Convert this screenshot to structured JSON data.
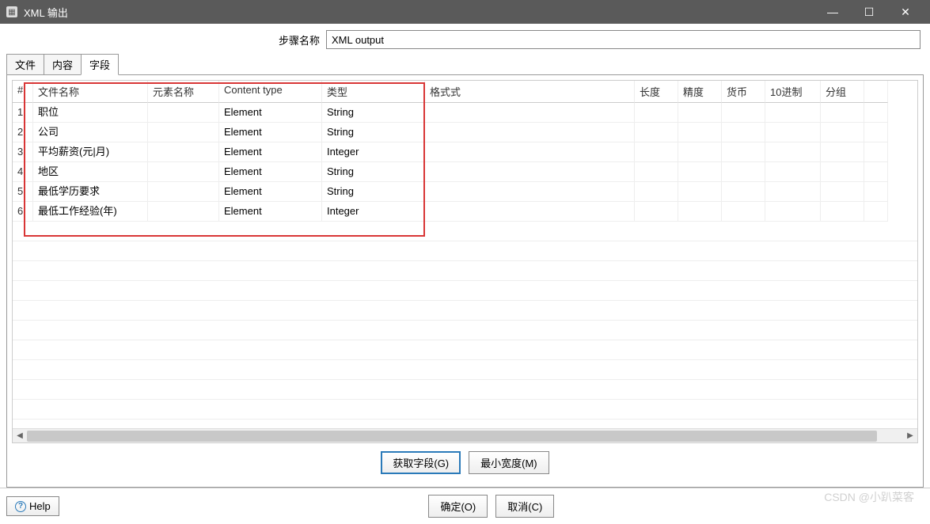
{
  "window": {
    "title": "XML 输出"
  },
  "step": {
    "label": "步骤名称",
    "value": "XML output"
  },
  "tabs": [
    {
      "label": "文件",
      "active": false
    },
    {
      "label": "内容",
      "active": false
    },
    {
      "label": "字段",
      "active": true
    }
  ],
  "columns": {
    "num": "#",
    "filename": "文件名称",
    "element": "元素名称",
    "contentType": "Content type",
    "type": "类型",
    "format": "格式式",
    "length": "长度",
    "precision": "精度",
    "currency": "货币",
    "decimal": "10进制",
    "group": "分组"
  },
  "rows": [
    {
      "n": "1",
      "filename": "职位",
      "element": "",
      "contentType": "Element",
      "type": "String",
      "format": "",
      "length": "",
      "precision": "",
      "currency": "",
      "decimal": "",
      "group": ""
    },
    {
      "n": "2",
      "filename": "公司",
      "element": "",
      "contentType": "Element",
      "type": "String",
      "format": "",
      "length": "",
      "precision": "",
      "currency": "",
      "decimal": "",
      "group": ""
    },
    {
      "n": "3",
      "filename": "平均薪资(元|月)",
      "element": "",
      "contentType": "Element",
      "type": "Integer",
      "format": "",
      "length": "",
      "precision": "",
      "currency": "",
      "decimal": "",
      "group": ""
    },
    {
      "n": "4",
      "filename": "地区",
      "element": "",
      "contentType": "Element",
      "type": "String",
      "format": "",
      "length": "",
      "precision": "",
      "currency": "",
      "decimal": "",
      "group": ""
    },
    {
      "n": "5",
      "filename": "最低学历要求",
      "element": "",
      "contentType": "Element",
      "type": "String",
      "format": "",
      "length": "",
      "precision": "",
      "currency": "",
      "decimal": "",
      "group": ""
    },
    {
      "n": "6",
      "filename": "最低工作经验(年)",
      "element": "",
      "contentType": "Element",
      "type": "Integer",
      "format": "",
      "length": "",
      "precision": "",
      "currency": "",
      "decimal": "",
      "group": ""
    }
  ],
  "buttons": {
    "getFields": "获取字段(G)",
    "minWidth": "最小宽度(M)",
    "ok": "确定(O)",
    "cancel": "取消(C)",
    "help": "Help"
  },
  "watermark": "CSDN @小趴菜客"
}
